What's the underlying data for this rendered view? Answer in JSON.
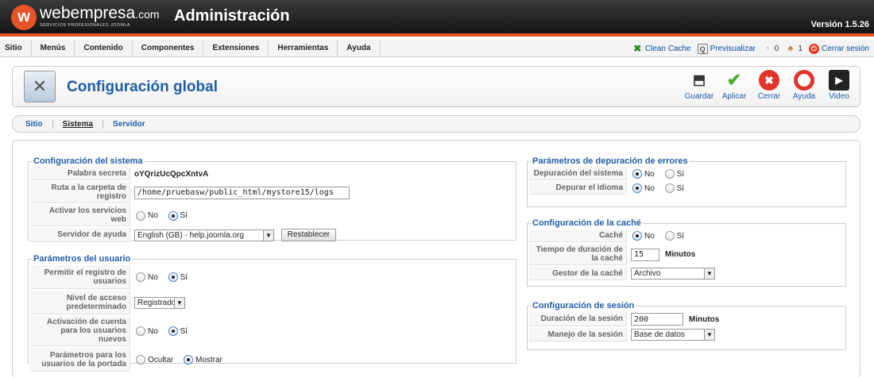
{
  "header": {
    "brand": "webempresa",
    "brand_suffix": ".com",
    "brand_tagline": "SERVICIOS PROFESIONALES JOOMLA",
    "logo_letter": "w",
    "title": "Administración",
    "version": "Versión 1.5.26"
  },
  "menu": [
    "Sitio",
    "Menús",
    "Contenido",
    "Componentes",
    "Extensiones",
    "Herramientas",
    "Ayuda"
  ],
  "status": {
    "clean_cache": "Clean Cache",
    "preview": "Previsualizar",
    "messages_count": "0",
    "users_count": "1",
    "logout": "Cerrar sesión"
  },
  "toolbar": {
    "title": "Configuración global",
    "save": "Guardar",
    "apply": "Aplicar",
    "close": "Cerrar",
    "help": "Ayuda",
    "video": "Video"
  },
  "subnav": {
    "tabs": [
      "Sitio",
      "Sistema",
      "Servidor"
    ],
    "active": "Sistema"
  },
  "system_config": {
    "legend": "Configuración del sistema",
    "secret_label": "Palabra secreta",
    "secret_value": "oYQrizUcQpcXntvA",
    "log_path_label": "Ruta a la carpeta de registro",
    "log_path_value": "/home/pruebasw/public_html/mystore15/logs",
    "web_services_label": "Activar los servicios web",
    "help_server_label": "Servidor de ayuda",
    "help_server_value": "English (GB) - help.joomla.org",
    "reset_button": "Restablecer"
  },
  "user_params": {
    "legend": "Parámetros del usuario",
    "allow_registration_label": "Permitir el registro de usuarios",
    "access_level_label": "Nivel de acceso predeterminado",
    "access_level_value": "Registrado",
    "activation_label": "Activación de cuenta para los usuarios nuevos",
    "frontend_params_label": "Parámetros para los usuarios de la portada"
  },
  "debug": {
    "legend": "Parámetros de depuración de errores",
    "system_debug_label": "Depuración del sistema",
    "language_debug_label": "Depurar el idioma"
  },
  "cache": {
    "legend": "Configuración de la caché",
    "cache_label": "Caché",
    "cache_time_label": "Tiempo de duración de la caché",
    "cache_time_value": "15",
    "cache_time_unit": "Minutos",
    "cache_handler_label": "Gestor de la caché",
    "cache_handler_value": "Archivo"
  },
  "session": {
    "legend": "Configuración de sesión",
    "lifetime_label": "Duración de la sesión",
    "lifetime_value": "200",
    "lifetime_unit": "Minutos",
    "handler_label": "Manejo de la sesión",
    "handler_value": "Base de datos"
  },
  "options": {
    "no": "No",
    "yes": "Sí",
    "hide": "Ocultar",
    "show": "Mostrar"
  },
  "colors": {
    "accent": "#e8542a",
    "link": "#1f5da8"
  }
}
